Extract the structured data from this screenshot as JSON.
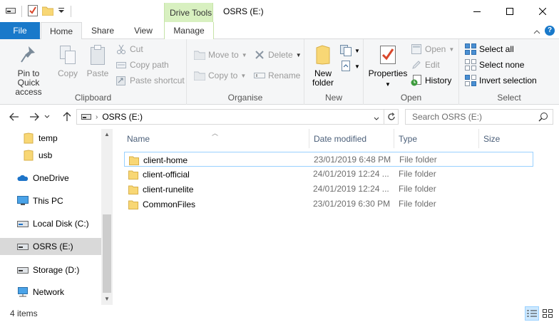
{
  "window": {
    "title": "OSRS (E:)",
    "context_tab_band": "Drive Tools"
  },
  "tabs": {
    "file": "File",
    "home": "Home",
    "share": "Share",
    "view": "View",
    "manage": "Manage"
  },
  "ribbon": {
    "clipboard": {
      "label": "Clipboard",
      "pin": "Pin to Quick access",
      "copy": "Copy",
      "paste": "Paste",
      "cut": "Cut",
      "copy_path": "Copy path",
      "paste_shortcut": "Paste shortcut"
    },
    "organise": {
      "label": "Organise",
      "move_to": "Move to",
      "copy_to": "Copy to",
      "delete": "Delete",
      "rename": "Rename"
    },
    "new": {
      "label": "New",
      "new_folder": "New folder"
    },
    "open": {
      "label": "Open",
      "properties": "Properties",
      "open": "Open",
      "edit": "Edit",
      "history": "History"
    },
    "select": {
      "label": "Select",
      "select_all": "Select all",
      "select_none": "Select none",
      "invert_selection": "Invert selection"
    }
  },
  "address": {
    "path": "OSRS (E:)",
    "search_placeholder": "Search OSRS (E:)"
  },
  "nav": {
    "items": [
      {
        "label": "temp"
      },
      {
        "label": "usb"
      },
      {
        "label": "OneDrive"
      },
      {
        "label": "This PC"
      },
      {
        "label": "Local Disk (C:)"
      },
      {
        "label": "OSRS (E:)"
      },
      {
        "label": "Storage (D:)"
      },
      {
        "label": "Network"
      }
    ]
  },
  "columns": {
    "name": "Name",
    "date_modified": "Date modified",
    "type": "Type",
    "size": "Size"
  },
  "files": [
    {
      "name": "client-home",
      "date": "23/01/2019 6:48 PM",
      "type": "File folder"
    },
    {
      "name": "client-official",
      "date": "24/01/2019 12:24 ...",
      "type": "File folder"
    },
    {
      "name": "client-runelite",
      "date": "24/01/2019 12:24 ...",
      "type": "File folder"
    },
    {
      "name": "CommonFiles",
      "date": "23/01/2019 6:30 PM",
      "type": "File folder"
    }
  ],
  "status": {
    "item_count": "4 items"
  },
  "colors": {
    "file_tab": "#1979ca",
    "drive_tools": "#d8f0c0",
    "folder": "#f8d775",
    "selection_border": "#99d1ff"
  }
}
